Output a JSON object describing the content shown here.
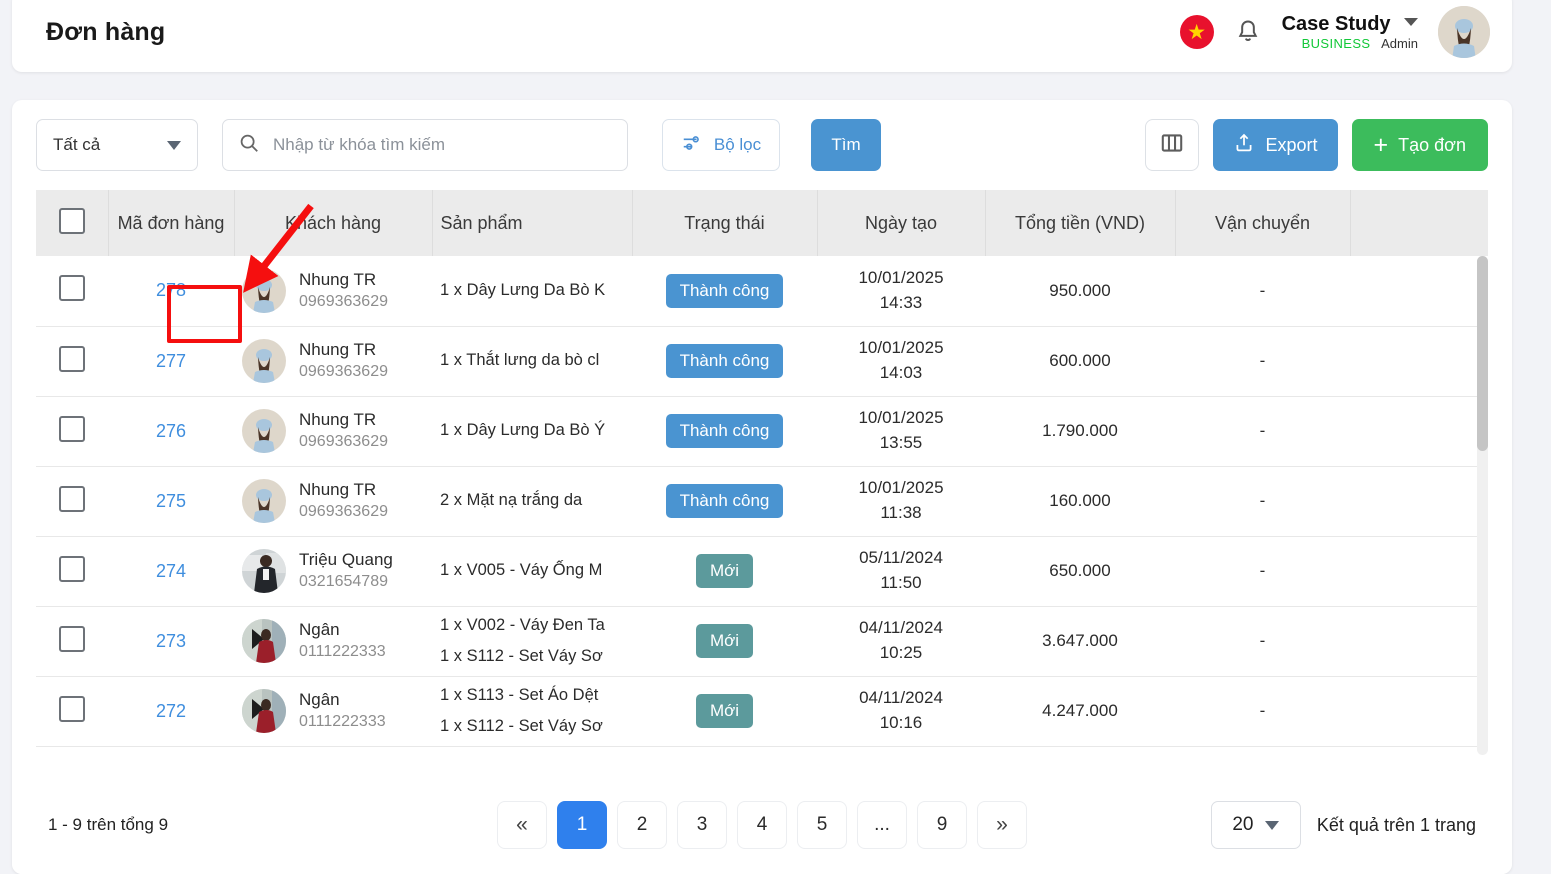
{
  "header": {
    "title": "Đơn hàng",
    "flag_icon": "vietnam-flag-icon",
    "bell_icon": "bell-icon",
    "account_name": "Case Study",
    "account_plan": "BUSINESS",
    "account_role": "Admin"
  },
  "toolbar": {
    "scope_filter": "Tất cả",
    "search_placeholder": "Nhập từ khóa tìm kiếm",
    "search_value": "",
    "filter_label": "Bộ lọc",
    "search_label": "Tìm",
    "columns_icon": "columns-icon",
    "export_label": "Export",
    "create_label": "Tạo đơn"
  },
  "table": {
    "columns": [
      "Mã đơn hàng",
      "Khách hàng",
      "Sản phẩm",
      "Trạng thái",
      "Ngày tạo",
      "Tổng tiền (VND)",
      "Vận chuyển"
    ],
    "rows": [
      {
        "code": "278",
        "customer": "Nhung TR",
        "phone": "0969363629",
        "products": [
          "1 x Dây Lưng Da Bò K"
        ],
        "status": "Thành công",
        "status_type": "success",
        "date": "10/01/2025",
        "time": "14:33",
        "total": "950.000",
        "shipping": "-"
      },
      {
        "code": "277",
        "customer": "Nhung TR",
        "phone": "0969363629",
        "products": [
          "1 x Thắt lưng da bò cl"
        ],
        "status": "Thành công",
        "status_type": "success",
        "date": "10/01/2025",
        "time": "14:03",
        "total": "600.000",
        "shipping": "-"
      },
      {
        "code": "276",
        "customer": "Nhung TR",
        "phone": "0969363629",
        "products": [
          "1 x Dây Lưng Da Bò Ý"
        ],
        "status": "Thành công",
        "status_type": "success",
        "date": "10/01/2025",
        "time": "13:55",
        "total": "1.790.000",
        "shipping": "-"
      },
      {
        "code": "275",
        "customer": "Nhung TR",
        "phone": "0969363629",
        "products": [
          "2 x Mặt nạ trắng da"
        ],
        "status": "Thành công",
        "status_type": "success",
        "date": "10/01/2025",
        "time": "11:38",
        "total": "160.000",
        "shipping": "-"
      },
      {
        "code": "274",
        "customer": "Triệu Quang",
        "phone": "0321654789",
        "products": [
          "1 x V005 - Váy Ống M"
        ],
        "status": "Mới",
        "status_type": "new",
        "date": "05/11/2024",
        "time": "11:50",
        "total": "650.000",
        "shipping": "-"
      },
      {
        "code": "273",
        "customer": "Ngân",
        "phone": "0111222333",
        "products": [
          "1 x V002 - Váy Đen Ta",
          "1 x S112 - Set Váy Sơ"
        ],
        "status": "Mới",
        "status_type": "new",
        "date": "04/11/2024",
        "time": "10:25",
        "total": "3.647.000",
        "shipping": "-"
      },
      {
        "code": "272",
        "customer": "Ngân",
        "phone": "0111222333",
        "products": [
          "1 x S113 - Set Áo Dệt",
          "1 x S112 - Set Váy Sơ"
        ],
        "status": "Mới",
        "status_type": "new",
        "date": "04/11/2024",
        "time": "10:16",
        "total": "4.247.000",
        "shipping": "-"
      }
    ]
  },
  "footer": {
    "summary": "1 - 9 trên tổng 9",
    "pages": [
      "1",
      "2",
      "3",
      "4",
      "5",
      "...",
      "9"
    ],
    "active_page": "1",
    "first_icon": "«",
    "last_icon": "»",
    "per_page": "20",
    "per_page_label": "Kết quả trên 1 trang"
  },
  "annotation": {
    "highlight_target": "278",
    "color": "#f50f0f"
  }
}
